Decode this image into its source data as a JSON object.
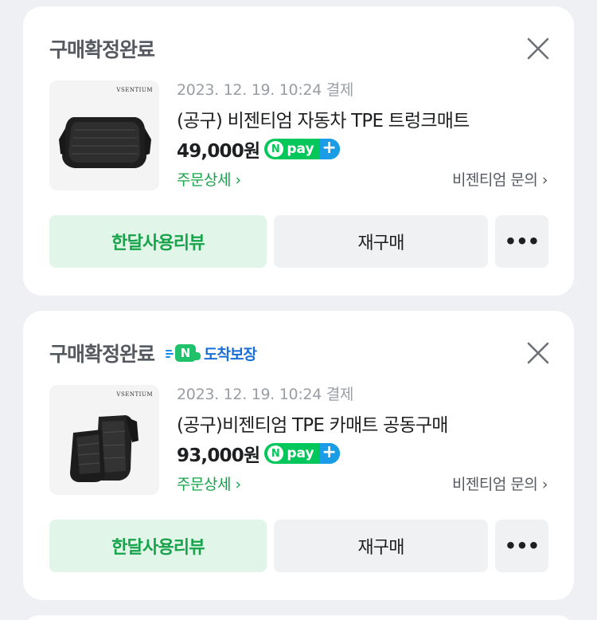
{
  "orders": [
    {
      "status": "구매확정완료",
      "badge": null,
      "thumb_brand": "VSENTIUM",
      "date": "2023. 12. 19. 10:24 결제",
      "title": "(공구) 비젠티엄 자동차 TPE 트렁크매트",
      "price": "49,000원",
      "detail_link": "주문상세 ›",
      "seller_link": "비젠티엄 문의 ›",
      "review_button": "한달사용리뷰",
      "rebuy_button": "재구매",
      "more_button": "•••"
    },
    {
      "status": "구매확정완료",
      "badge": "도착보장",
      "thumb_brand": "VSENTIUM",
      "date": "2023. 12. 19. 10:24 결제",
      "title": "(공구)비젠티엄 TPE 카매트 공동구매",
      "price": "93,000원",
      "detail_link": "주문상세 ›",
      "seller_link": "비젠티엄 문의 ›",
      "review_button": "한달사용리뷰",
      "rebuy_button": "재구매",
      "more_button": "•••"
    }
  ],
  "npay": {
    "n": "N",
    "text": "pay",
    "plus": "+"
  },
  "badge_n": "N",
  "colors": {
    "green": "#17a34a",
    "npay_green": "#03c75a",
    "blue": "#1a6fd6",
    "background": "#eef0f3"
  },
  "icons": [
    "close-icon",
    "npay-logo",
    "delivery-guarantee-icon",
    "more-icon"
  ]
}
